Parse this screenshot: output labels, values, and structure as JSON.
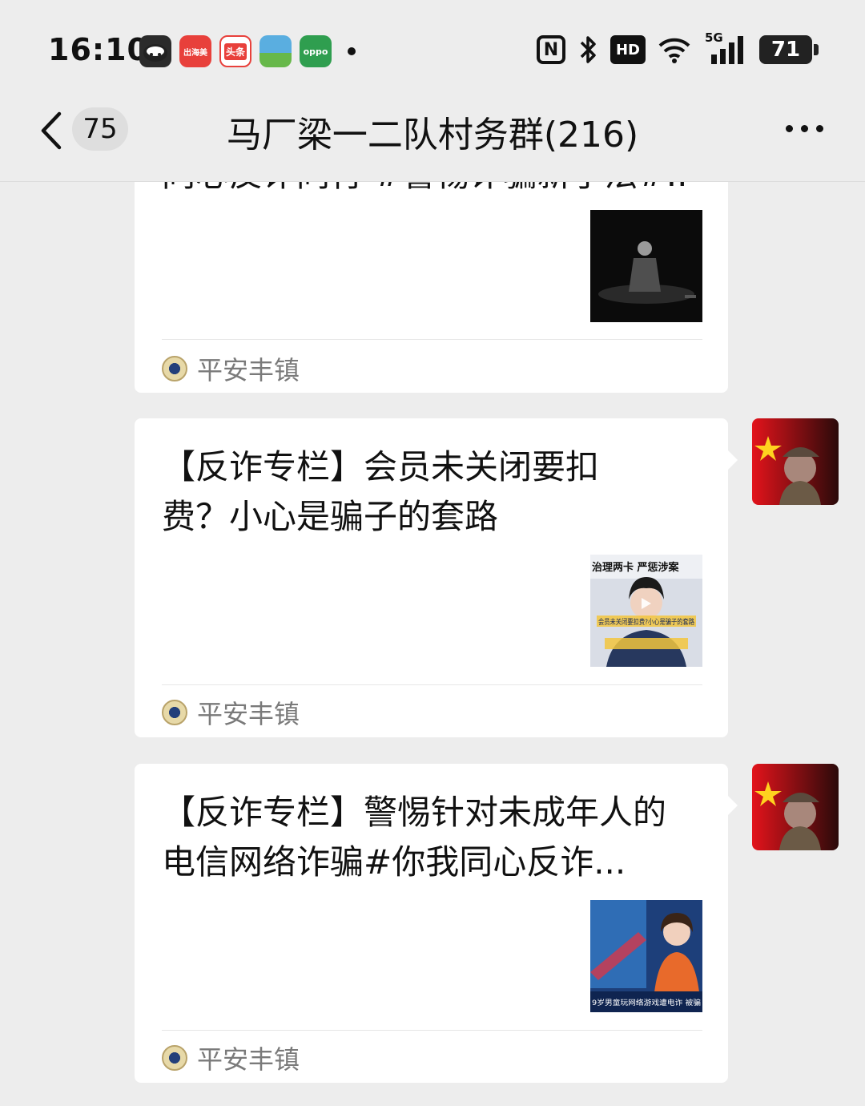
{
  "status_bar": {
    "time": "16:10",
    "apps": [
      {
        "name": "cartoon-app-icon",
        "label": "",
        "color": "#2b2b2b"
      },
      {
        "name": "chuhaomei-app-icon",
        "label": "出海美",
        "color": "#e8403b"
      },
      {
        "name": "toutiao-app-icon",
        "label": "头条",
        "color": "#e8403b"
      },
      {
        "name": "landscape-app-icon",
        "label": "",
        "color": "#4aa3d8"
      },
      {
        "name": "oppo-app-icon",
        "label": "oppo",
        "color": "#2f9e4f"
      }
    ],
    "hd_label": "HD",
    "network_label": "5G",
    "battery": "71"
  },
  "nav": {
    "unread_count": "75",
    "title": "马厂梁一二队村务群(216)"
  },
  "messages": [
    {
      "title": "同心反诈同行 #警惕诈骗新手法#...",
      "source": "平安丰镇",
      "thumb": "video-thumbnail-officer"
    },
    {
      "title": "【反诈专栏】会员未关闭要扣费？小心是骗子的套路",
      "source": "平安丰镇",
      "thumb": "video-thumbnail-policewoman",
      "thumb_caption": "治理两卡 严惩涉案",
      "thumb_caption2": "会员未关闭要扣费?小心是骗子的套路"
    },
    {
      "title": "【反诈专栏】警惕针对未成年人的电信网络诈骗#你我同心反诈...",
      "source": "平安丰镇",
      "thumb": "video-thumbnail-news-anchor",
      "thumb_caption": "9岁男童玩网络游戏遭电诈 被骗"
    }
  ],
  "colors": {
    "background": "#ededed",
    "card": "#ffffff",
    "source_text": "#7a7a7a"
  }
}
